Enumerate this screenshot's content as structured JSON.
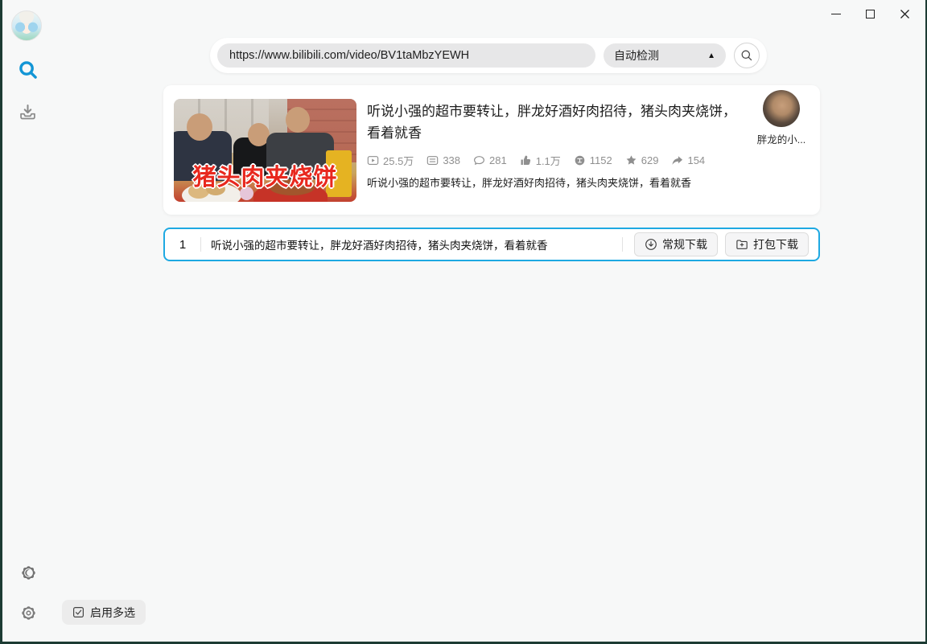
{
  "header": {
    "url_value": "https://www.bilibili.com/video/BV1taMbzYEWH",
    "detect_label": "自动检测",
    "dropdown_arrow": "▲"
  },
  "video_card": {
    "title": "听说小强的超市要转让，胖龙好酒好肉招待，猪头肉夹烧饼，看着就香",
    "thumbnail_overlay": "猪头肉夹烧饼",
    "stats": [
      {
        "icon": "play-count-icon",
        "value": "25.5万"
      },
      {
        "icon": "danmaku-icon",
        "value": "338"
      },
      {
        "icon": "comment-icon",
        "value": "281"
      },
      {
        "icon": "like-icon",
        "value": "1.1万"
      },
      {
        "icon": "coin-icon",
        "value": "1152"
      },
      {
        "icon": "favorite-icon",
        "value": "629"
      },
      {
        "icon": "share-icon",
        "value": "154"
      }
    ],
    "description": "听说小强的超市要转让，胖龙好酒好肉招待，猪头肉夹烧饼，看着就香",
    "uploader_name": "胖龙的小..."
  },
  "download_row": {
    "index": "1",
    "title": "听说小强的超市要转让，胖龙好酒好肉招待，猪头肉夹烧饼，看着就香",
    "regular_download_label": "常规下载",
    "pack_download_label": "打包下载"
  },
  "footer": {
    "multi_select_label": "启用多选"
  },
  "colors": {
    "accent_blue": "#1295d5",
    "row_border_blue": "#1ea9e2",
    "edge_green": "#1d3c34",
    "thumbnail_text_red": "#e8281e"
  }
}
